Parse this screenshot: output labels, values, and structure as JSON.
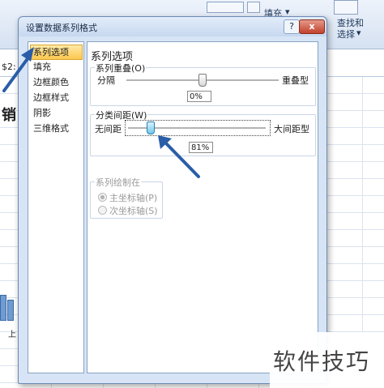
{
  "ribbon": {
    "fill_label": "填充",
    "find_select_label": "查找和",
    "select_label": "选择",
    "dropdown_marker": "▾"
  },
  "formula_bar": {
    "ref": "$2:"
  },
  "sheet": {
    "left_char": "销",
    "bottom_char": "上"
  },
  "dialog": {
    "title": "设置数据系列格式",
    "help_button": "?",
    "close_button": "x",
    "nav": [
      {
        "label": "系列选项",
        "active": true
      },
      {
        "label": "填充"
      },
      {
        "label": "边框颜色"
      },
      {
        "label": "边框样式"
      },
      {
        "label": "阴影"
      },
      {
        "label": "三维格式"
      }
    ],
    "panel_title": "系列选项",
    "overlap": {
      "group_title": "系列重叠(O)",
      "left_label": "分隔",
      "right_label": "重叠型",
      "value": "0%",
      "level": 0.5
    },
    "gap": {
      "group_title": "分类间距(W)",
      "left_label": "无间距",
      "right_label": "大间距型",
      "value": "81%",
      "level": 0.162
    },
    "plot_on": {
      "group_title": "系列绘制在",
      "primary_label": "主坐标轴(P)",
      "secondary_label": "次坐标轴(S)"
    }
  },
  "watermark": "软件技巧",
  "colors": {
    "arrow": "#2a5da8",
    "active_nav": "#fcc74e",
    "dialog_bg": "#d6e4f5"
  }
}
